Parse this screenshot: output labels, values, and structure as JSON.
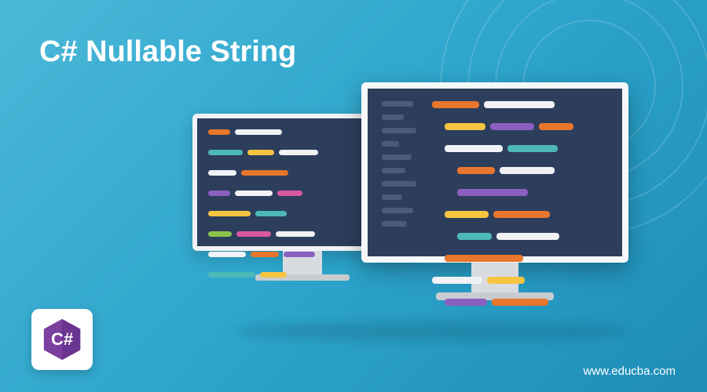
{
  "title": "C# Nullable String",
  "logo": {
    "language": "C#",
    "hex_color": "#7b3fa0"
  },
  "website_url": "www.educba.com",
  "colors": {
    "orange": "#e8762c",
    "yellow": "#f5c542",
    "purple": "#8b5fbf",
    "teal": "#4db8b8",
    "white": "#f0f2f5",
    "pink": "#d858a0",
    "green": "#8bc34a",
    "darkblue": "#2c3e5c",
    "sidebar": "#4a5c7a"
  }
}
